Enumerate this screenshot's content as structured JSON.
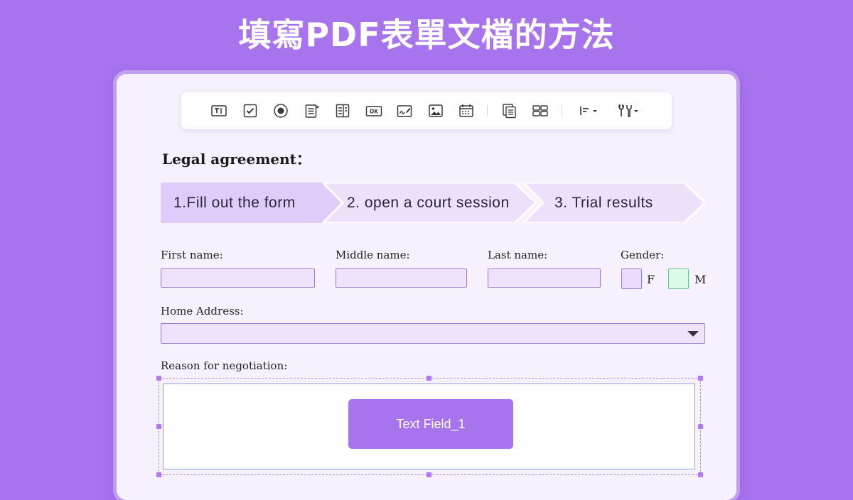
{
  "headline": "填寫PDF表單文檔的方法",
  "toolbar": {
    "tools": [
      {
        "name": "text-field-icon"
      },
      {
        "name": "checkbox-icon"
      },
      {
        "name": "radio-button-icon"
      },
      {
        "name": "combo-box-icon"
      },
      {
        "name": "list-box-icon"
      },
      {
        "name": "button-icon",
        "text": "OK"
      },
      {
        "name": "signature-icon"
      },
      {
        "name": "image-icon"
      },
      {
        "name": "date-icon"
      },
      {
        "name": "duplicate-icon"
      },
      {
        "name": "grid-icon"
      },
      {
        "name": "align-icon"
      },
      {
        "name": "tools-icon"
      }
    ]
  },
  "form": {
    "section_title": "Legal agreement：",
    "steps": [
      {
        "label": "1.Fill out the form",
        "active": true
      },
      {
        "label": "2. open a court session",
        "active": false
      },
      {
        "label": "3. Trial results",
        "active": false
      }
    ],
    "labels": {
      "first_name": "First name:",
      "middle_name": "Middle name:",
      "last_name": "Last name:",
      "gender": "Gender:",
      "home_address": "Home Address:",
      "reason": "Reason for negotiation:"
    },
    "gender_options": {
      "female": "F",
      "male": "M"
    },
    "values": {
      "first_name": "",
      "middle_name": "",
      "last_name": "",
      "home_address": ""
    },
    "text_field_tag": "Text Field_1"
  },
  "colors": {
    "background": "#a874ee",
    "active_step": "#dfccf8",
    "inactive_step": "#ece0fb",
    "female_box": "#ecdcfb",
    "male_box": "#dcfbe9",
    "accent": "#a874ee"
  }
}
